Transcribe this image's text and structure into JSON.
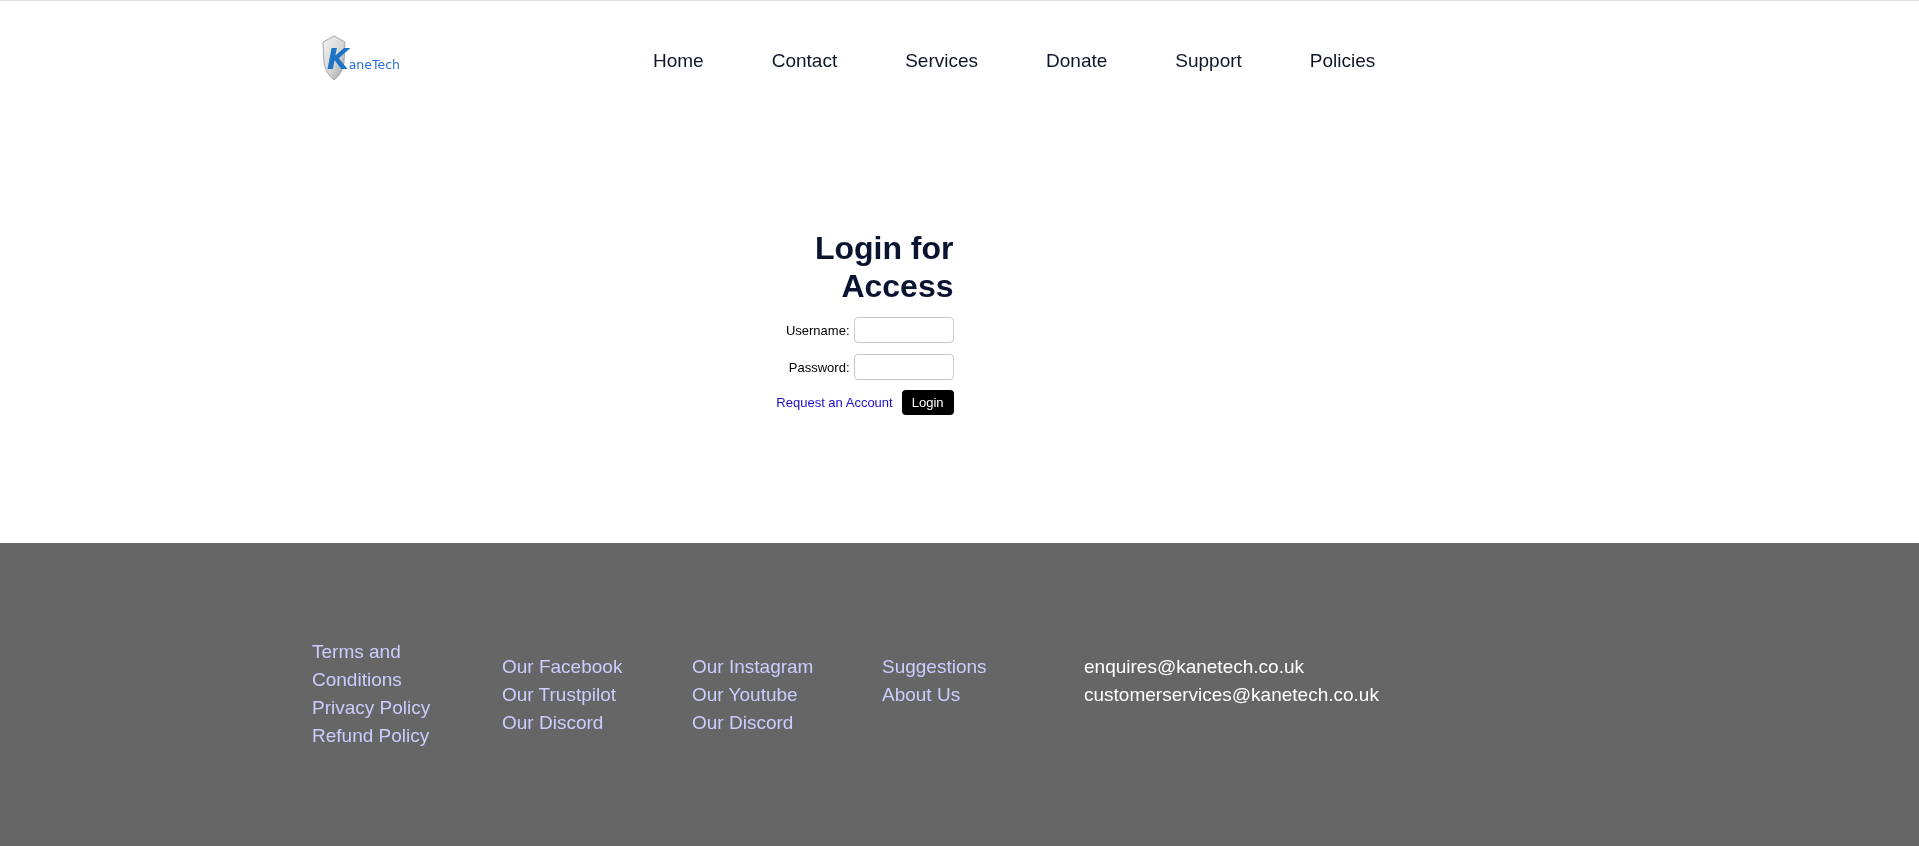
{
  "logo": {
    "wordmark": "KaneTech"
  },
  "nav": [
    "Home",
    "Contact",
    "Services",
    "Donate",
    "Support",
    "Policies"
  ],
  "login": {
    "title": "Login for Access",
    "fields": [
      {
        "label": "Username:"
      },
      {
        "label": "Password:"
      }
    ],
    "link": "Request an Account",
    "button": "Login"
  },
  "footer": {
    "columns": [
      {
        "kind": "links",
        "items": [
          "Terms and Conditions",
          "Privacy Policy",
          "Refund Policy"
        ]
      },
      {
        "kind": "links",
        "items": [
          "Our Facebook",
          "Our Trustpilot",
          "Our Discord"
        ]
      },
      {
        "kind": "links",
        "items": [
          "Our Instagram",
          "Our Youtube",
          "Our Discord"
        ]
      },
      {
        "kind": "links",
        "items": [
          "Suggestions",
          "About Us"
        ]
      },
      {
        "kind": "contact",
        "items": [
          "enquires@kanetech.co.uk",
          "customerservices@kanetech.co.uk"
        ]
      }
    ]
  }
}
